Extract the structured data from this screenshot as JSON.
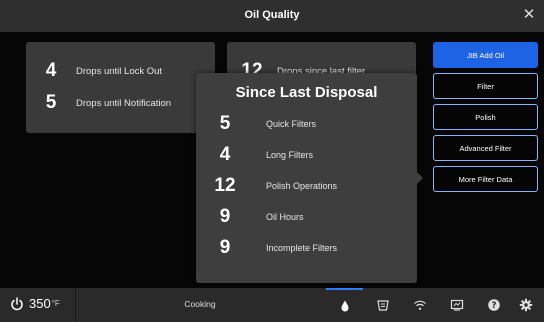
{
  "window": {
    "title": "Oil Quality",
    "close_icon": "close-icon"
  },
  "stats_left": [
    {
      "value": "4",
      "label": "Drops until Lock Out"
    },
    {
      "value": "5",
      "label": "Drops until Notification"
    }
  ],
  "stats_right": [
    {
      "value": "12",
      "label": "Drops since last filter"
    }
  ],
  "side_buttons": [
    {
      "label": "JIB Add Oil"
    },
    {
      "label": "Filter"
    },
    {
      "label": "Polish"
    },
    {
      "label": "Advanced Filter"
    },
    {
      "label": "More Filter Data"
    }
  ],
  "popup": {
    "title": "Since Last Disposal",
    "rows": [
      {
        "value": "5",
        "label": "Quick Filters"
      },
      {
        "value": "4",
        "label": "Long Filters"
      },
      {
        "value": "12",
        "label": "Polish Operations"
      },
      {
        "value": "9",
        "label": "Oil Hours"
      },
      {
        "value": "9",
        "label": "Incomplete Filters"
      }
    ]
  },
  "bottom_bar": {
    "temperature": "350",
    "temperature_unit": "°F",
    "status": "Cooking",
    "icons": [
      "oil-drop-icon",
      "fryer-icon",
      "wifi-icon",
      "display-icon",
      "help-icon",
      "settings-icon"
    ],
    "active_icon": "oil-drop-icon"
  },
  "colors": {
    "accent": "#1e63e6",
    "button_border": "#8ab4ff",
    "panel": "#3a3a3a",
    "bar": "#2a2a2a"
  }
}
